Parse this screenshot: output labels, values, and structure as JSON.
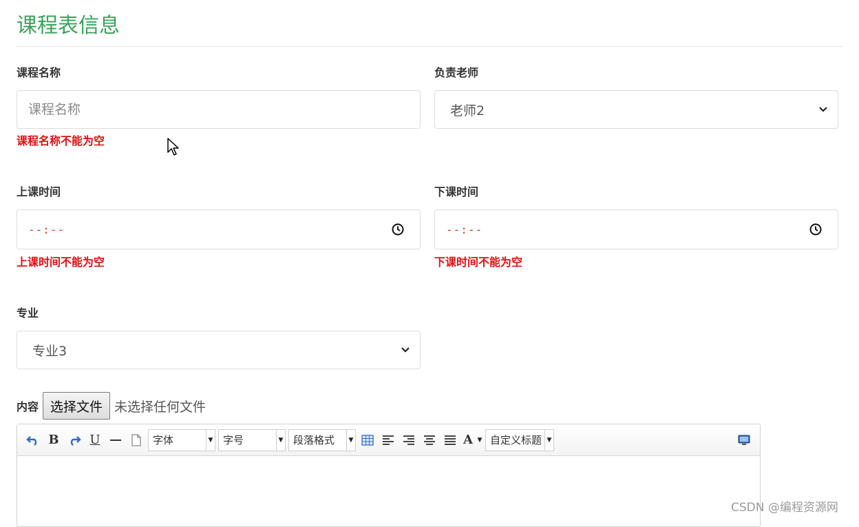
{
  "page_title": "课程表信息",
  "course_name": {
    "label": "课程名称",
    "placeholder": "课程名称",
    "value": "",
    "error": "课程名称不能为空"
  },
  "teacher": {
    "label": "负责老师",
    "selected": "老师2"
  },
  "start_time": {
    "label": "上课时间",
    "value": "--:--",
    "error": "上课时间不能为空"
  },
  "end_time": {
    "label": "下课时间",
    "value": "--:--",
    "error": "下课时间不能为空"
  },
  "major": {
    "label": "专业",
    "selected": "专业3"
  },
  "content": {
    "label": "内容",
    "file_button": "选择文件",
    "file_status": "未选择任何文件"
  },
  "editor": {
    "bold": "B",
    "underline": "U",
    "font_combo": "字体",
    "size_combo": "字号",
    "paragraph_combo": "段落格式",
    "font_color": "A",
    "custom_title_combo": "自定义标题"
  },
  "watermark": "CSDN @编程资源网",
  "colors": {
    "title": "#3aa35a",
    "error": "#e01010",
    "time_placeholder": "#cc3b2a"
  }
}
